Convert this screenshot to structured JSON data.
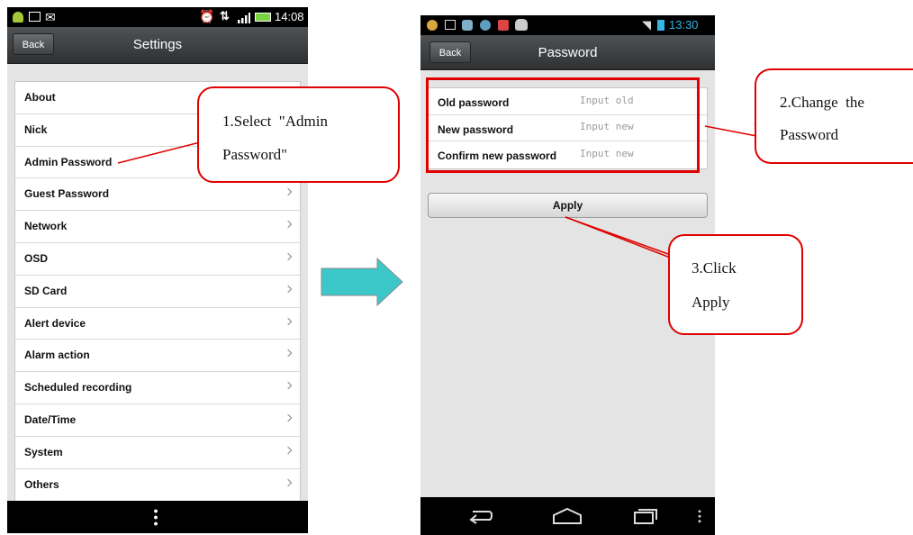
{
  "screen1": {
    "status_time": "14:08",
    "title": "Settings",
    "back_label": "Back",
    "items": [
      {
        "label": "About"
      },
      {
        "label": "Nick"
      },
      {
        "label": "Admin Password"
      },
      {
        "label": "Guest Password"
      },
      {
        "label": "Network"
      },
      {
        "label": "OSD"
      },
      {
        "label": "SD Card"
      },
      {
        "label": "Alert device"
      },
      {
        "label": "Alarm action"
      },
      {
        "label": "Scheduled recording"
      },
      {
        "label": "Date/Time"
      },
      {
        "label": "System"
      },
      {
        "label": "Others"
      }
    ]
  },
  "screen2": {
    "status_time": "13:30",
    "title": "Password",
    "back_label": "Back",
    "fields": [
      {
        "label": "Old password",
        "placeholder": "Input old"
      },
      {
        "label": "New password",
        "placeholder": "Input new"
      },
      {
        "label": "Confirm new password",
        "placeholder": "Input new"
      }
    ],
    "apply_label": "Apply"
  },
  "callouts": {
    "step1_line1": "1.Select  \"Admin",
    "step1_line2": "Password\"",
    "step2_line1": "2.Change  the",
    "step2_line2": "Password",
    "step3_line1": "3.Click",
    "step3_line2": "Apply"
  },
  "colors": {
    "callout": "#e00000",
    "arrow": "#3cc7c9",
    "titlebar": "#3a3c3e",
    "statusbar": "#000000",
    "accent_time": "#33b5e5"
  }
}
